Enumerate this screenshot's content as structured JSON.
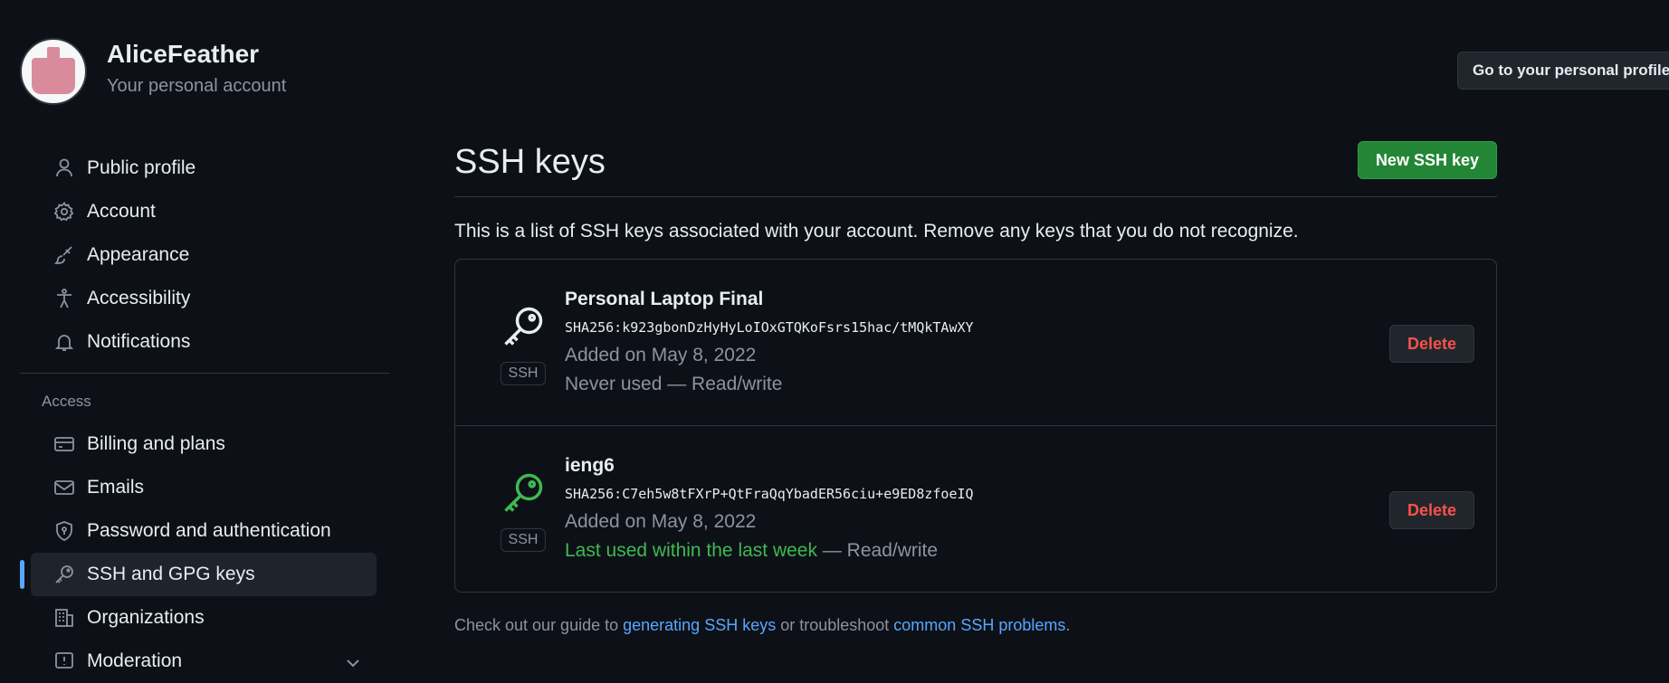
{
  "account": {
    "name": "AliceFeather",
    "subtitle": "Your personal account",
    "goto_button": "Go to your personal profile"
  },
  "sidebar": {
    "items": [
      {
        "label": "Public profile",
        "icon": "person-icon"
      },
      {
        "label": "Account",
        "icon": "gear-icon"
      },
      {
        "label": "Appearance",
        "icon": "paintbrush-icon"
      },
      {
        "label": "Accessibility",
        "icon": "accessibility-icon"
      },
      {
        "label": "Notifications",
        "icon": "bell-icon"
      }
    ],
    "access_label": "Access",
    "access_items": [
      {
        "label": "Billing and plans",
        "icon": "credit-card-icon"
      },
      {
        "label": "Emails",
        "icon": "mail-icon"
      },
      {
        "label": "Password and authentication",
        "icon": "shield-lock-icon"
      },
      {
        "label": "SSH and GPG keys",
        "icon": "key-icon",
        "active": true
      },
      {
        "label": "Organizations",
        "icon": "organization-icon"
      },
      {
        "label": "Moderation",
        "icon": "report-icon"
      }
    ]
  },
  "main": {
    "title": "SSH keys",
    "new_button": "New SSH key",
    "intro": "This is a list of SSH keys associated with your account. Remove any keys that you do not recognize.",
    "keys": [
      {
        "title": "Personal Laptop Final",
        "fingerprint": "SHA256:k923gbonDzHyHyLoIOxGTQKoFsrs15hac/tMQkTAwXY",
        "added": "Added on May 8, 2022",
        "usage_status": "Never used",
        "usage_suffix": " — Read/write",
        "badge": "SSH",
        "delete": "Delete",
        "icon_color": "#e6edf3"
      },
      {
        "title": "ieng6",
        "fingerprint": "SHA256:C7eh5w8tFXrP+QtFraQqYbadER56ciu+e9ED8zfoeIQ",
        "added": "Added on May 8, 2022",
        "usage_status": "Last used within the last week",
        "usage_suffix": " — Read/write",
        "badge": "SSH",
        "delete": "Delete",
        "icon_color": "#3fb950"
      }
    ],
    "footer": {
      "prefix": "Check out our guide to ",
      "link1": "generating SSH keys",
      "middle": " or troubleshoot ",
      "link2": "common SSH problems",
      "suffix": "."
    }
  },
  "colors": {
    "background": "#0d1117",
    "accent_green": "#238636",
    "danger": "#f85149",
    "link": "#58a6ff"
  }
}
